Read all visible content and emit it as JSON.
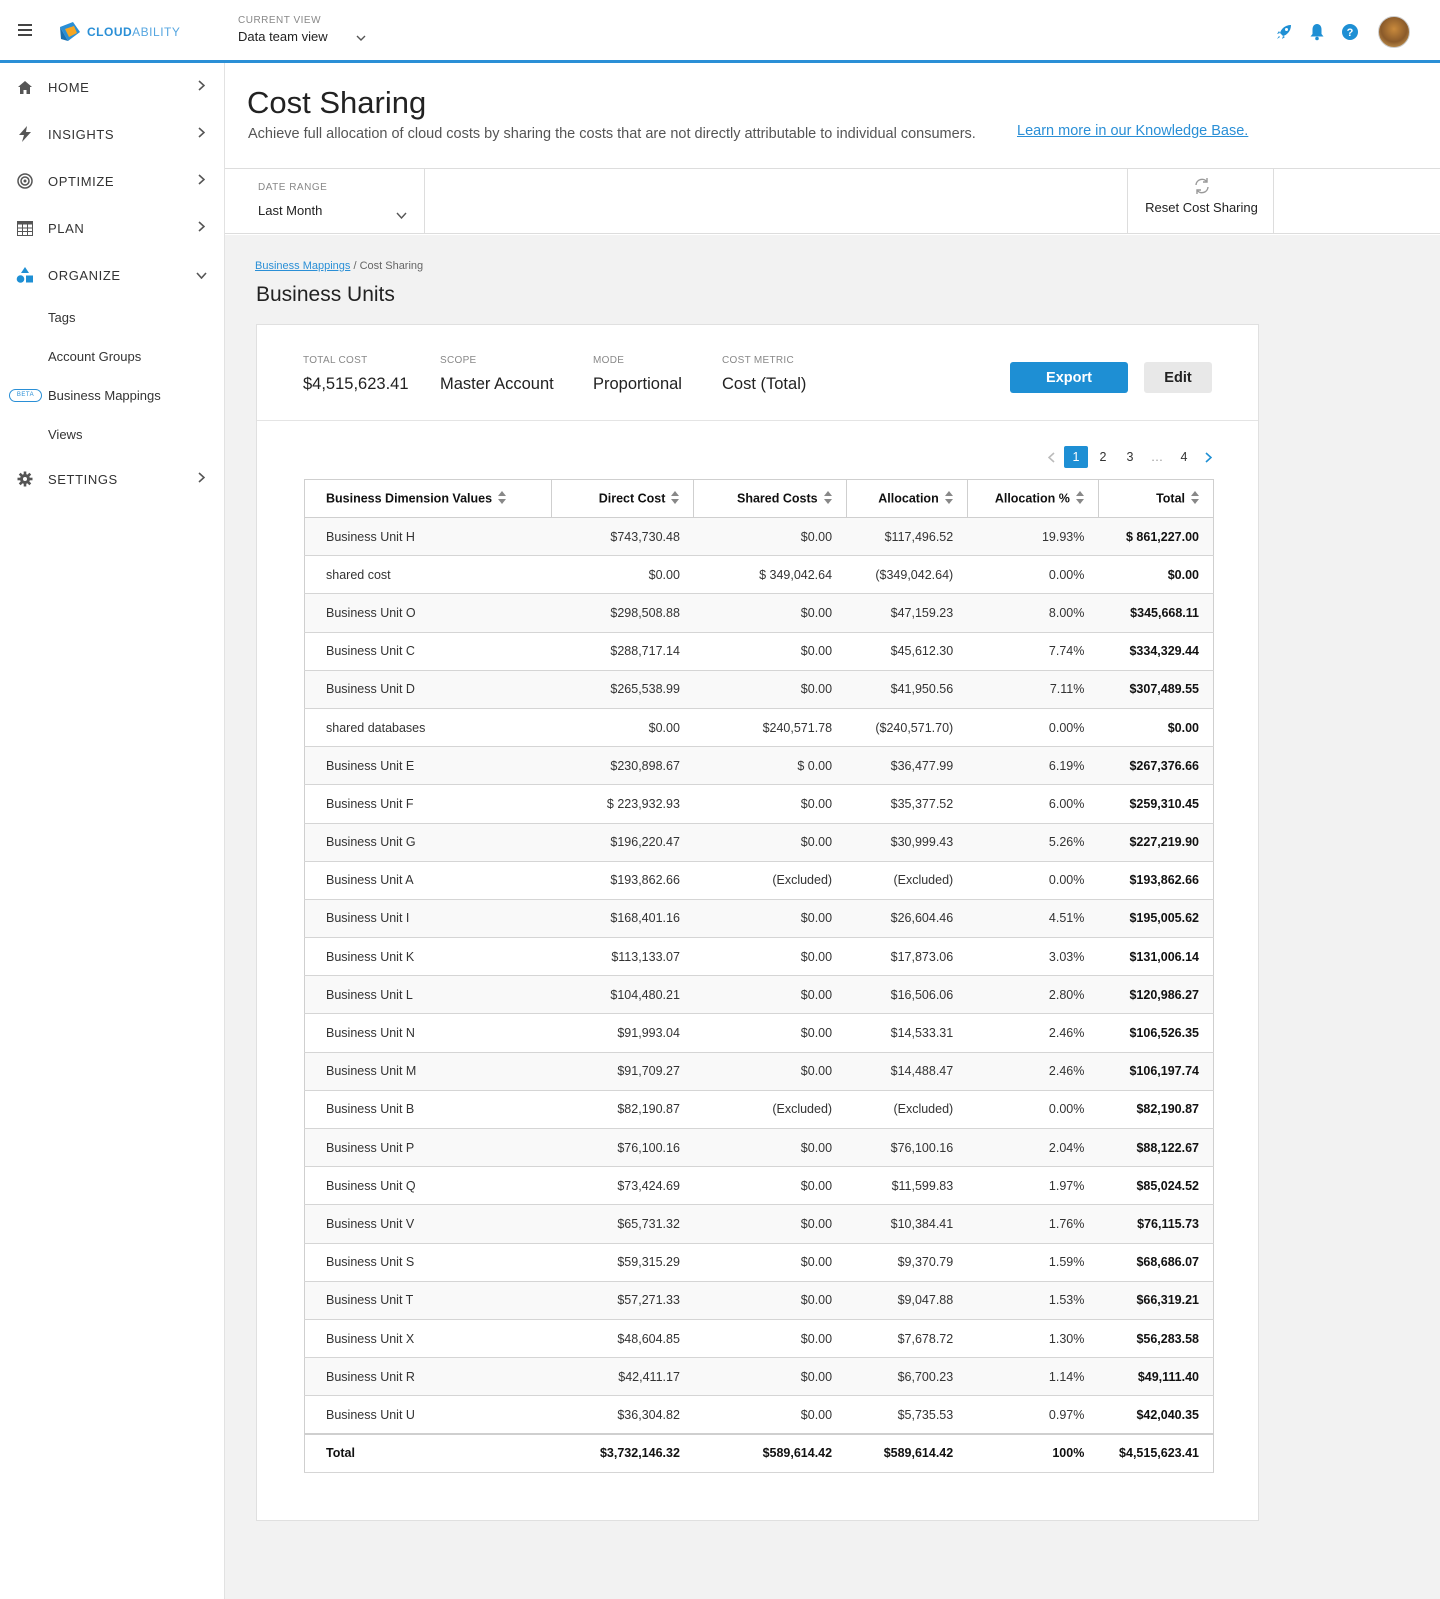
{
  "topbar": {
    "logo_text_bold": "CLOUD",
    "logo_text_light": "ABILITY",
    "current_view_label": "CURRENT VIEW",
    "current_view_value": "Data team view",
    "icons": [
      "rocket-icon",
      "bell-icon",
      "help-icon"
    ],
    "accent_color": "#2a8fd6"
  },
  "sidebar": {
    "items": [
      {
        "label": "HOME",
        "icon": "home-icon"
      },
      {
        "label": "INSIGHTS",
        "icon": "lightning-icon"
      },
      {
        "label": "OPTIMIZE",
        "icon": "target-icon"
      },
      {
        "label": "PLAN",
        "icon": "calendar-grid-icon"
      },
      {
        "label": "ORGANIZE",
        "icon": "shapes-icon"
      },
      {
        "label": "SETTINGS",
        "icon": "gear-icon"
      }
    ],
    "organize_sub": [
      {
        "label": "Tags"
      },
      {
        "label": "Account Groups"
      },
      {
        "label": "Business Mappings",
        "badge": "BETA"
      },
      {
        "label": "Views"
      }
    ]
  },
  "header": {
    "title": "Cost Sharing",
    "description": "Achieve full allocation of cloud costs by sharing the costs that are not directly attributable to individual consumers.",
    "link": "Learn more in our Knowledge Base."
  },
  "filters": {
    "date_range_label": "DATE RANGE",
    "date_range_value": "Last Month",
    "reset_label": "Reset Cost Sharing"
  },
  "breadcrumb": {
    "parent": "Business Mappings",
    "separator": " / ",
    "current": "Cost Sharing"
  },
  "section_title": "Business Units",
  "summary": {
    "total_cost_label": "TOTAL COST",
    "total_cost_value": "$4,515,623.41",
    "scope_label": "SCOPE",
    "scope_value": "Master Account",
    "mode_label": "MODE",
    "mode_value": "Proportional",
    "metric_label": "COST METRIC",
    "metric_value": "Cost (Total)",
    "export_label": "Export",
    "edit_label": "Edit"
  },
  "pagination": {
    "pages": [
      "1",
      "2",
      "3",
      "…",
      "4"
    ],
    "active": "1"
  },
  "table": {
    "columns": [
      "Business Dimension Values",
      "Direct Cost",
      "Shared Costs",
      "Allocation",
      "Allocation %",
      "Total"
    ],
    "rows": [
      [
        "Business Unit H",
        "$743,730.48",
        "$0.00",
        "$117,496.52",
        "19.93%",
        "$ 861,227.00"
      ],
      [
        "shared cost",
        "$0.00",
        "$ 349,042.64",
        "($349,042.64)",
        "0.00%",
        "$0.00"
      ],
      [
        "Business Unit O",
        "$298,508.88",
        "$0.00",
        "$47,159.23",
        "8.00%",
        "$345,668.11"
      ],
      [
        "Business Unit C",
        "$288,717.14",
        "$0.00",
        "$45,612.30",
        "7.74%",
        "$334,329.44"
      ],
      [
        "Business Unit D",
        "$265,538.99",
        "$0.00",
        "$41,950.56",
        "7.11%",
        "$307,489.55"
      ],
      [
        "shared databases",
        "$0.00",
        "$240,571.78",
        "($240,571.70)",
        "0.00%",
        "$0.00"
      ],
      [
        "Business Unit E",
        "$230,898.67",
        "$ 0.00",
        "$36,477.99",
        "6.19%",
        "$267,376.66"
      ],
      [
        "Business Unit F",
        "$ 223,932.93",
        "$0.00",
        "$35,377.52",
        "6.00%",
        "$259,310.45"
      ],
      [
        "Business Unit G",
        "$196,220.47",
        "$0.00",
        "$30,999.43",
        "5.26%",
        "$227,219.90"
      ],
      [
        "Business Unit A",
        "$193,862.66",
        "(Excluded)",
        "(Excluded)",
        "0.00%",
        "$193,862.66"
      ],
      [
        "Business Unit I",
        "$168,401.16",
        "$0.00",
        "$26,604.46",
        "4.51%",
        "$195,005.62"
      ],
      [
        "Business Unit K",
        "$113,133.07",
        "$0.00",
        "$17,873.06",
        "3.03%",
        "$131,006.14"
      ],
      [
        "Business Unit L",
        "$104,480.21",
        "$0.00",
        "$16,506.06",
        "2.80%",
        "$120,986.27"
      ],
      [
        "Business Unit N",
        "$91,993.04",
        "$0.00",
        "$14,533.31",
        "2.46%",
        "$106,526.35"
      ],
      [
        "Business Unit M",
        "$91,709.27",
        "$0.00",
        "$14,488.47",
        "2.46%",
        "$106,197.74"
      ],
      [
        "Business Unit B",
        "$82,190.87",
        "(Excluded)",
        "(Excluded)",
        "0.00%",
        "$82,190.87"
      ],
      [
        "Business Unit P",
        "$76,100.16",
        "$0.00",
        "$76,100.16",
        "2.04%",
        "$88,122.67"
      ],
      [
        "Business Unit Q",
        "$73,424.69",
        "$0.00",
        "$11,599.83",
        "1.97%",
        "$85,024.52"
      ],
      [
        "Business Unit V",
        "$65,731.32",
        "$0.00",
        "$10,384.41",
        "1.76%",
        "$76,115.73"
      ],
      [
        "Business Unit S",
        "$59,315.29",
        "$0.00",
        "$9,370.79",
        "1.59%",
        "$68,686.07"
      ],
      [
        "Business Unit T",
        "$57,271.33",
        "$0.00",
        "$9,047.88",
        "1.53%",
        "$66,319.21"
      ],
      [
        "Business Unit X",
        "$48,604.85",
        "$0.00",
        "$7,678.72",
        "1.30%",
        "$56,283.58"
      ],
      [
        "Business Unit R",
        "$42,411.17",
        "$0.00",
        "$6,700.23",
        "1.14%",
        "$49,111.40"
      ],
      [
        "Business Unit U",
        "$36,304.82",
        "$0.00",
        "$5,735.53",
        "0.97%",
        "$42,040.35"
      ]
    ],
    "footer": [
      "Total",
      "$3,732,146.32",
      "$589,614.42",
      "$589,614.42",
      "100%",
      "$4,515,623.41"
    ]
  }
}
